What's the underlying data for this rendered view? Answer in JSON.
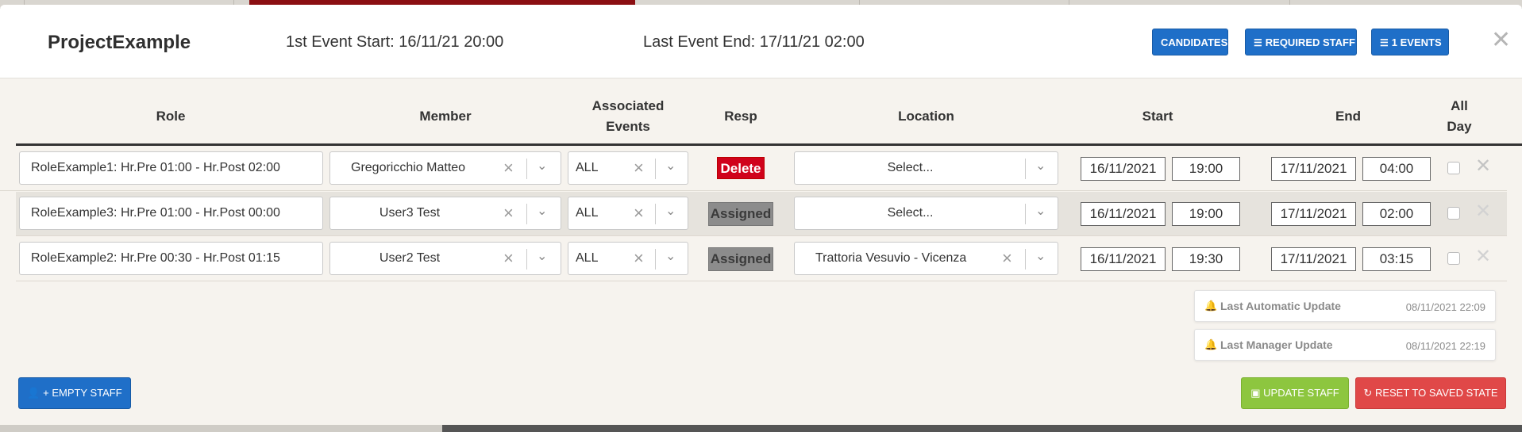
{
  "header": {
    "title": "ProjectExample",
    "first_event_start": "1st Event Start: 16/11/21 20:00",
    "last_event_end": "Last Event End: 17/11/21 02:00",
    "buttons": {
      "candidates": "CANDIDATES",
      "required_staff": "REQUIRED STAFF",
      "events": "1 EVENTS"
    },
    "close_glyph": "✕"
  },
  "columns": {
    "role": "Role",
    "member": "Member",
    "associated_1": "Associated",
    "associated_2": "Events",
    "resp": "Resp",
    "location": "Location",
    "start": "Start",
    "end": "End",
    "allday_1": "All",
    "allday_2": "Day"
  },
  "rows": [
    {
      "role": "RoleExample1: Hr.Pre 01:00 - Hr.Post 02:00",
      "member": "Gregoricchio Matteo",
      "events": "ALL",
      "resp": "Delete",
      "location": "Select...",
      "start_date": "16/11/2021",
      "start_time": "19:00",
      "end_date": "17/11/2021",
      "end_time": "04:00"
    },
    {
      "role": "RoleExample3: Hr.Pre 01:00 - Hr.Post 00:00",
      "member": "User3 Test",
      "events": "ALL",
      "resp": "Assigned",
      "location": "Select...",
      "start_date": "16/11/2021",
      "start_time": "19:00",
      "end_date": "17/11/2021",
      "end_time": "02:00"
    },
    {
      "role": "RoleExample2: Hr.Pre 00:30 - Hr.Post 01:15",
      "member": "User2 Test",
      "events": "ALL",
      "resp": "Assigned",
      "location": "Trattoria Vesuvio - Vicenza",
      "start_date": "16/11/2021",
      "start_time": "19:30",
      "end_date": "17/11/2021",
      "end_time": "03:15"
    }
  ],
  "updates": {
    "automatic_label": "Last Automatic Update",
    "automatic_date": "08/11/2021 22:09",
    "manager_label": "Last Manager Update",
    "manager_date": "08/11/2021 22:19"
  },
  "footer": {
    "empty_staff": "+ EMPTY STAFF",
    "update_staff": "UPDATE STAFF",
    "reset": "RESET TO SAVED STATE"
  },
  "colors": {
    "primary": "#1f6fc8",
    "success": "#8dc63f",
    "danger": "#e04848",
    "delete_badge": "#d0021b",
    "assigned_badge": "#8c8c8c"
  }
}
